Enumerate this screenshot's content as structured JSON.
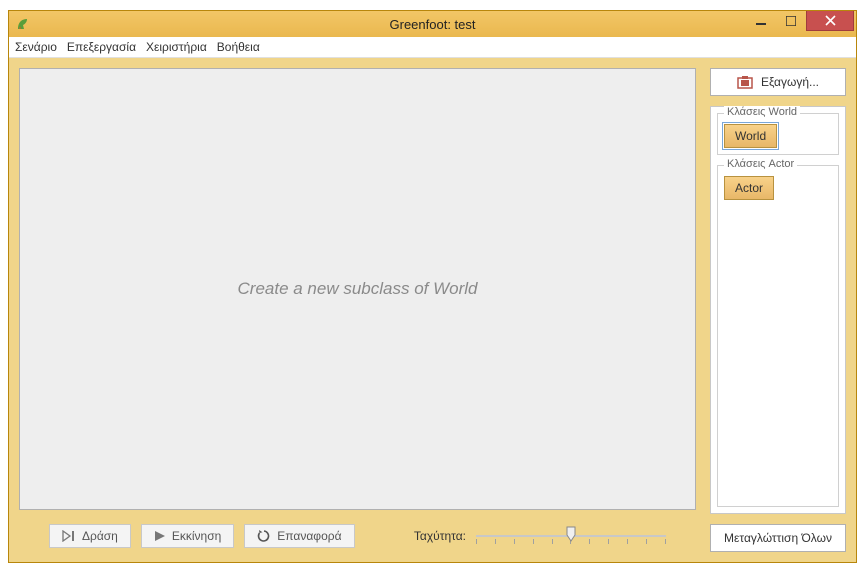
{
  "window": {
    "title": "Greenfoot: test"
  },
  "menu": {
    "items": [
      "Σενάριο",
      "Επεξεργασία",
      "Χειριστήρια",
      "Βοήθεια"
    ]
  },
  "world": {
    "placeholder": "Create a new subclass of World"
  },
  "controls": {
    "act": "Δράση",
    "run": "Εκκίνηση",
    "reset": "Επαναφορά",
    "speed_label": "Ταχύτητα:"
  },
  "sidebar": {
    "export": "Εξαγωγή...",
    "world_group": "Κλάσεις World",
    "world_class": "World",
    "actor_group": "Κλάσεις Actor",
    "actor_class": "Actor",
    "compile": "Μεταγλώττιση Όλων"
  }
}
